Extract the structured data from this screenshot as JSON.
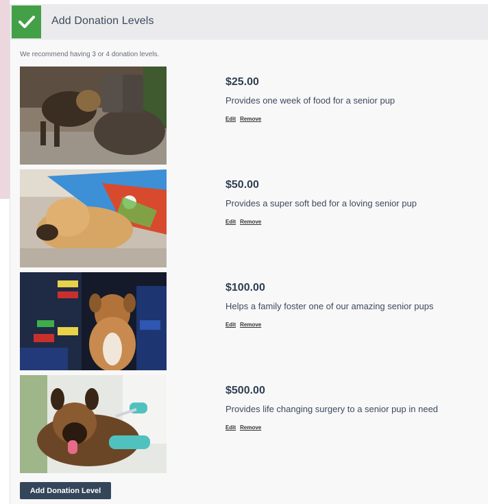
{
  "header": {
    "title": "Add Donation Levels",
    "icon": "check-icon"
  },
  "hint": "We recommend having 3 or 4 donation levels.",
  "colors": {
    "accent_green": "#43a047",
    "button_navy": "#344659"
  },
  "levels": [
    {
      "amount": "$25.00",
      "description": "Provides one week of food for a senior pup",
      "edit": "Edit",
      "remove": "Remove"
    },
    {
      "amount": "$50.00",
      "description": "Provides a super soft bed for a loving senior pup",
      "edit": "Edit",
      "remove": "Remove"
    },
    {
      "amount": "$100.00",
      "description": "Helps a family foster one of our amazing senior pups",
      "edit": "Edit",
      "remove": "Remove"
    },
    {
      "amount": "$500.00",
      "description": "Provides life changing surgery to a senior pup in need",
      "edit": "Edit",
      "remove": "Remove"
    }
  ],
  "add_button_label": "Add Donation Level"
}
